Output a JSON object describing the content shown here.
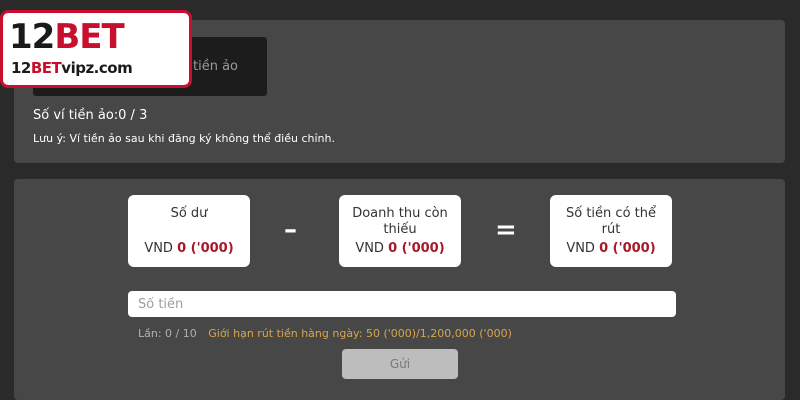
{
  "logo": {
    "main_number": "12",
    "main_brand": "BET",
    "sub_prefix": "12",
    "sub_brand": "BET",
    "sub_suffix": "vipz.com"
  },
  "wallet": {
    "add_label": "tiền ảo",
    "count_text": "Số ví tiền ảo:0 / 3",
    "note": "Lưu ý: Ví tiền ảo sau khi đăng ký không thể điều chỉnh."
  },
  "withdraw": {
    "balance": {
      "title": "Số dư",
      "unit": "VND",
      "amount": "0 ('000)"
    },
    "minus": "–",
    "turnover": {
      "title_line1": "Doanh thu còn",
      "title_line2": "thiếu",
      "unit": "VND",
      "amount": "0 ('000)"
    },
    "equals": "=",
    "available": {
      "title_line1": "Số tiền có thể",
      "title_line2": "rút",
      "unit": "VND",
      "amount": "0 ('000)"
    },
    "amount_placeholder": "Số tiền",
    "attempts": "Lần: 0 / 10",
    "daily_limit": "Giới hạn rút tiền hàng ngày: 50 ('000)/1,200,000 ('000)",
    "submit_label": "Gửi"
  },
  "colors": {
    "brand_red": "#c8102e",
    "amount_red": "#a8182a",
    "limit_gold": "#d7a64a"
  }
}
